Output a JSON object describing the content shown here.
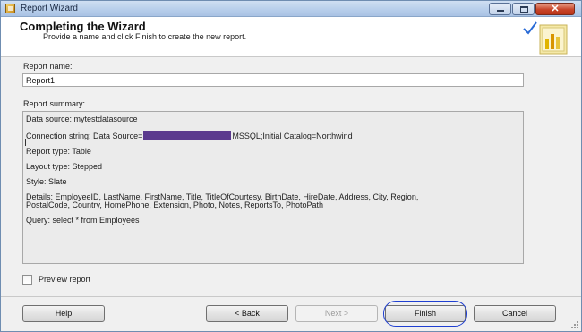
{
  "window": {
    "title": "Report Wizard",
    "close_glyph": "✕"
  },
  "header": {
    "title": "Completing the Wizard",
    "subtitle": "Provide a name and click Finish to create the new report."
  },
  "report_name": {
    "label": "Report name:",
    "value": "Report1"
  },
  "summary": {
    "label": "Report summary:",
    "data_source": "Data source: mytestdatasource",
    "connection_prefix": "Connection string: Data Source=",
    "connection_suffix": "MSSQL;Initial Catalog=Northwind",
    "report_type": "Report type: Table",
    "layout_type": "Layout type: Stepped",
    "style": "Style: Slate",
    "details_line1": "Details: EmployeeID, LastName, FirstName, Title, TitleOfCourtesy, BirthDate, HireDate, Address, City, Region,",
    "details_line2": "PostalCode, Country, HomePhone, Extension, Photo, Notes, ReportsTo, PhotoPath",
    "query": "Query:  select * from Employees"
  },
  "preview": {
    "label": "Preview report",
    "checked": false
  },
  "buttons": {
    "help": "Help",
    "back": "< Back",
    "next": "Next >",
    "finish": "Finish",
    "cancel": "Cancel"
  },
  "colors": {
    "redaction": "#5b3a8e",
    "finish_highlight": "#1f3fd1"
  }
}
